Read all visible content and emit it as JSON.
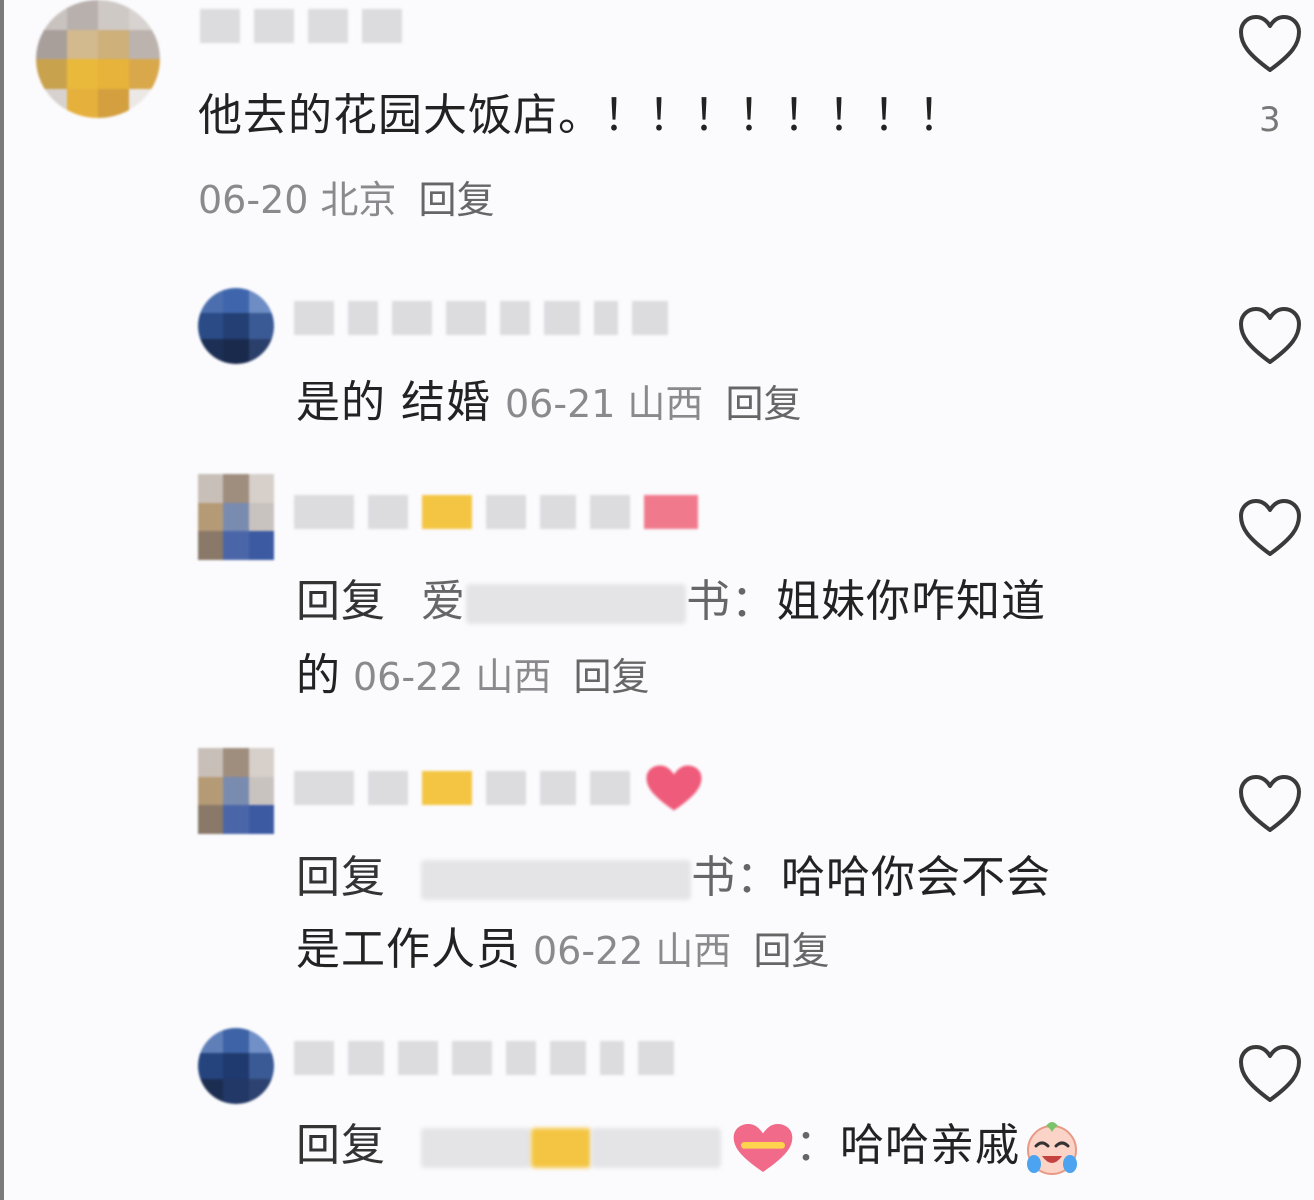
{
  "comments": [
    {
      "text": "他去的花园大饭店。！！！！！！！！",
      "date": "06-20",
      "location": "北京",
      "reply_label": "回复",
      "like_count": "3"
    },
    {
      "text": "是的 结婚",
      "date": "06-21",
      "location": "山西",
      "reply_label": "回复"
    },
    {
      "reply_prefix": "回复",
      "name_first_char": "爱",
      "name_last_char": "书",
      "colon": "：",
      "text_line1": "姐妹你咋知道",
      "text_line2": "的",
      "date": "06-22",
      "location": "山西",
      "reply_label": "回复"
    },
    {
      "reply_prefix": "回复",
      "name_last_char": "书",
      "colon": "：",
      "text_line1": "哈哈你会不会",
      "text_line2": "是工作人员",
      "date": "06-22",
      "location": "山西",
      "reply_label": "回复"
    },
    {
      "reply_prefix": "回复",
      "colon": "：",
      "text_line1": "哈哈亲戚"
    }
  ],
  "colors": {
    "background": "#fbfbfd",
    "meta_text": "#8a8a8e",
    "heart_outline": "#3a3a3a"
  },
  "icons": [
    "heart-outline-icon",
    "heart-emoji-icon",
    "crying-laugh-emoji-icon"
  ]
}
